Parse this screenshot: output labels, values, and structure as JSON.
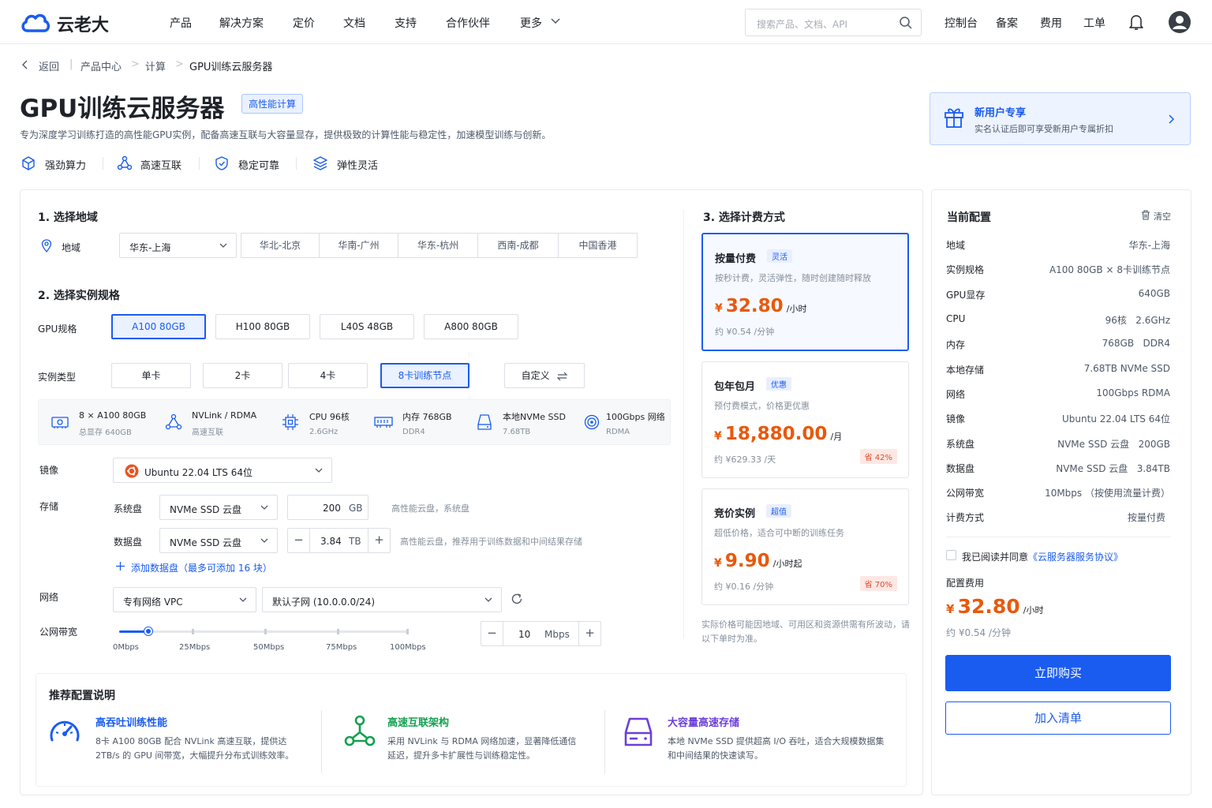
{
  "colors": {
    "primary": "#1a5cf0",
    "price": "#e8590c",
    "save": "#e04b2b"
  },
  "header": {
    "logo": "云老大",
    "nav": [
      "产品",
      "解决方案",
      "定价",
      "文档",
      "支持",
      "合作伙伴",
      "更多"
    ],
    "search_placeholder": "搜索产品、文档、API",
    "right": [
      "控制台",
      "备案",
      "费用",
      "工单"
    ]
  },
  "breadcrumb": {
    "back": "返回",
    "items": [
      "产品中心",
      "计算",
      "GPU训练云服务器"
    ]
  },
  "title": {
    "text": "GPU训练云服务器",
    "tag": "高性能计算",
    "desc": "专为深度学习训练打造的高性能GPU实例，配备高速互联与大容量显存，提供极致的计算性能与稳定性，加速模型训练与创新。",
    "features": [
      "强劲算力",
      "高速互联",
      "稳定可靠",
      "弹性灵活"
    ]
  },
  "promo": {
    "title": "新用户专享",
    "desc": "实名认证后即可享受新用户专属折扣"
  },
  "region": {
    "section": "1. 选择地域",
    "label": "地域",
    "selected": "华东-上海",
    "options": [
      "华北-北京",
      "华南-广州",
      "华东-杭州",
      "西南-成都",
      "中国香港"
    ]
  },
  "spec": {
    "section": "2. 选择实例规格",
    "gpu_label": "GPU规格",
    "gpus": [
      "A100 80GB",
      "H100 80GB",
      "L40S 48GB",
      "A800 80GB"
    ],
    "type_label": "实例类型",
    "types": [
      "单卡",
      "2卡",
      "4卡",
      "8卡训练节点"
    ],
    "custom": "自定义",
    "specs": [
      {
        "a": "8 × A100 80GB",
        "b": "总显存 640GB"
      },
      {
        "a": "NVLink / RDMA",
        "b": "高速互联"
      },
      {
        "a": "CPU 96核",
        "b": "2.6GHz"
      },
      {
        "a": "内存 768GB",
        "b": "DDR4"
      },
      {
        "a": "本地NVMe SSD",
        "b": "7.68TB"
      },
      {
        "a": "100Gbps 网络",
        "b": "RDMA"
      }
    ]
  },
  "image": {
    "label": "镜像",
    "value": "Ubuntu 22.04 LTS 64位"
  },
  "storage": {
    "label": "存储",
    "sys_label": "系统盘",
    "sys_type": "NVMe SSD 云盘",
    "sys_size": "200",
    "sys_unit": "GB",
    "sys_hint": "高性能云盘，系统盘",
    "data_label": "数据盘",
    "data_type": "NVMe SSD 云盘",
    "data_size": "3.84",
    "data_unit": "TB",
    "data_hint": "高性能云盘，推荐用于训练数据和中间结果存储",
    "add": "添加数据盘（最多可添加 16 块）"
  },
  "network": {
    "label": "网络",
    "vpc": "专有网络 VPC",
    "subnet": "默认子网 (10.0.0.0/24)"
  },
  "bandwidth": {
    "label": "公网带宽",
    "ticks": [
      "0Mbps",
      "25Mbps",
      "50Mbps",
      "75Mbps",
      "100Mbps"
    ],
    "value": "10",
    "unit": "Mbps",
    "fraction": 0.1
  },
  "billing": {
    "section": "3. 选择计费方式",
    "cards": [
      {
        "name": "按量付费",
        "tag": "灵活",
        "desc": "按秒计费，灵活弹性，随时创建随时释放",
        "cur": "¥",
        "price": "32.80",
        "unit": "/小时",
        "sub": "约 ¥0.54 /分钟",
        "save": ""
      },
      {
        "name": "包年包月",
        "tag": "优惠",
        "desc": "预付费模式，价格更优惠",
        "cur": "¥",
        "price": "18,880.00",
        "unit": "/月",
        "sub": "约 ¥629.33 /天",
        "save": "省 42%"
      },
      {
        "name": "竞价实例",
        "tag": "超值",
        "desc": "超低价格，适合可中断的训练任务",
        "cur": "¥",
        "price": "9.90",
        "unit": "/小时起",
        "sub": "约 ¥0.16 /分钟",
        "save": "省 70%"
      }
    ],
    "note": "实际价格可能因地域、可用区和资源供需有所波动，请以下单时为准。"
  },
  "recommend": {
    "title": "推荐配置说明",
    "items": [
      {
        "h": "高吞吐训练性能",
        "p": "8卡 A100 80GB 配合 NVLink 高速互联，提供达 2TB/s 的 GPU 间带宽，大幅提升分布式训练效率。",
        "color": "#1a5cf0"
      },
      {
        "h": "高速互联架构",
        "p": "采用 NVLink 与 RDMA 网络加速，显著降低通信延迟，提升多卡扩展性与训练稳定性。",
        "color": "#12a150"
      },
      {
        "h": "大容量高速存储",
        "p": "本地 NVMe SSD 提供超高 I/O 吞吐，适合大规模数据集和中间结果的快速读写。",
        "color": "#6b3fd8"
      }
    ]
  },
  "summary": {
    "title": "当前配置",
    "clear": "清空",
    "rows": [
      {
        "k": "地域",
        "v": "华东-上海"
      },
      {
        "k": "实例规格",
        "v": "A100 80GB × 8卡训练节点"
      },
      {
        "k": "GPU显存",
        "v": "640GB"
      },
      {
        "k": "CPU",
        "v": "96核   2.6GHz"
      },
      {
        "k": "内存",
        "v": "768GB   DDR4"
      },
      {
        "k": "本地存储",
        "v": "7.68TB NVMe SSD"
      },
      {
        "k": "网络",
        "v": "100Gbps RDMA"
      },
      {
        "k": "镜像",
        "v": "Ubuntu 22.04 LTS 64位"
      },
      {
        "k": "系统盘",
        "v": "NVMe SSD 云盘   200GB"
      },
      {
        "k": "数据盘",
        "v": "NVMe SSD 云盘   3.84TB"
      },
      {
        "k": "公网带宽",
        "v": "10Mbps （按使用流量计费）"
      },
      {
        "k": "计费方式",
        "v": "按量付费"
      }
    ],
    "agree_prefix": "我已阅读并同意",
    "agree_link": "《云服务器服务协议》",
    "fee_label": "配置费用",
    "cur": "¥",
    "price": "32.80",
    "unit": "/小时",
    "sub": "约 ¥0.54 /分钟",
    "buy": "立即购买",
    "cart": "加入清单"
  }
}
